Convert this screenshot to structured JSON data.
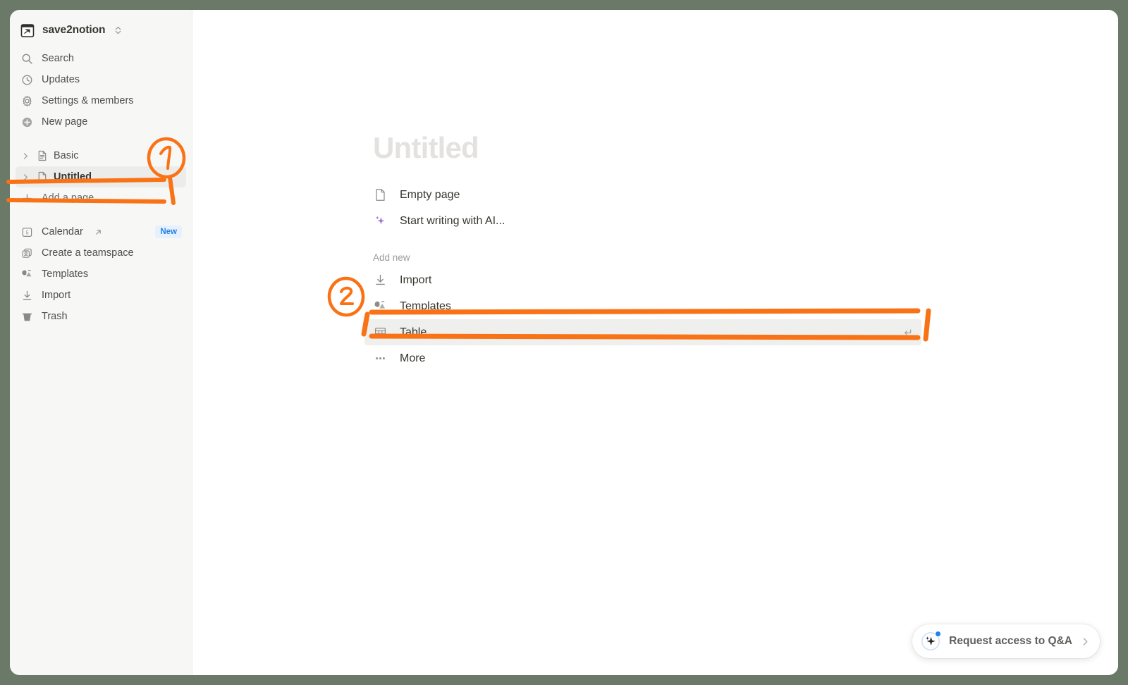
{
  "window": {
    "frame_color": "#6b7a68",
    "background": "#ffffff"
  },
  "sidebar": {
    "background": "#f7f7f5",
    "workspace": {
      "name": "save2notion",
      "icon": "notion-workspace-icon",
      "switcher_icon": "chevron-up-down-icon"
    },
    "nav_items": [
      {
        "label": "Search",
        "icon": "search-icon"
      },
      {
        "label": "Updates",
        "icon": "clock-icon"
      },
      {
        "label": "Settings & members",
        "icon": "gear-icon"
      },
      {
        "label": "New page",
        "icon": "plus-circle-icon"
      }
    ],
    "pages": [
      {
        "label": "Basic",
        "icon": "document-lines-icon",
        "twisty": "chevron-right-icon",
        "selected": false,
        "bold": false
      },
      {
        "label": "Untitled",
        "icon": "document-blank-icon",
        "twisty": "chevron-right-icon",
        "selected": true,
        "bold": true
      }
    ],
    "add_page": {
      "label": "Add a page",
      "icon": "plus-icon"
    },
    "bottom_items": [
      {
        "label": "Calendar",
        "icon": "calendar-icon",
        "external": true,
        "external_icon": "arrow-up-right-icon",
        "badge": "New"
      },
      {
        "label": "Create a teamspace",
        "icon": "teamspace-icon",
        "external": false,
        "badge": ""
      },
      {
        "label": "Templates",
        "icon": "templates-icon",
        "external": false,
        "badge": ""
      },
      {
        "label": "Import",
        "icon": "import-download-icon",
        "external": false,
        "badge": ""
      },
      {
        "label": "Trash",
        "icon": "trash-icon",
        "external": false,
        "badge": ""
      }
    ]
  },
  "main": {
    "title_placeholder": "Untitled",
    "primary_options": [
      {
        "label": "Empty page",
        "icon": "document-blank-icon",
        "highlight": false,
        "enter_hint": ""
      },
      {
        "label": "Start writing with AI...",
        "icon": "ai-sparkle-icon",
        "highlight": false,
        "enter_hint": ""
      }
    ],
    "add_new_label": "Add new",
    "add_new_options": [
      {
        "label": "Import",
        "icon": "import-download-icon",
        "highlight": false,
        "enter_hint": ""
      },
      {
        "label": "Templates",
        "icon": "templates-icon",
        "highlight": false,
        "enter_hint": ""
      },
      {
        "label": "Table",
        "icon": "table-grid-icon",
        "highlight": true,
        "enter_hint": "↵"
      },
      {
        "label": "More",
        "icon": "ellipsis-icon",
        "highlight": false,
        "enter_hint": ""
      }
    ]
  },
  "qa_widget": {
    "label": "Request access to Q&A",
    "icon": "ai-sparkle-circle-icon",
    "chevron": "chevron-right-icon",
    "has_notification_dot": true,
    "dot_color": "#2383e2"
  },
  "annotations": {
    "color": "#f97316",
    "markers": [
      {
        "number": "1",
        "target": "add-a-page-row"
      },
      {
        "number": "2",
        "target": "table-option-row"
      }
    ]
  }
}
